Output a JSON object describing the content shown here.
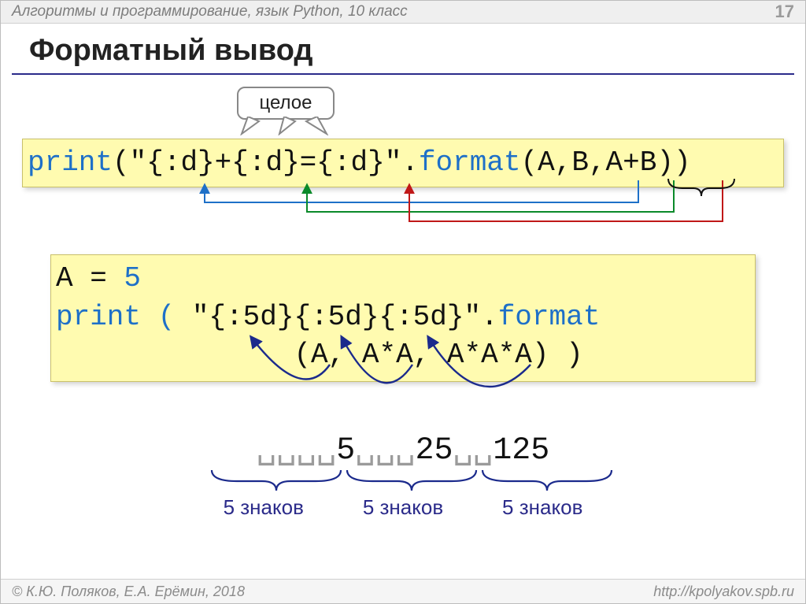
{
  "header": {
    "left": "Алгоритмы и программирование, язык Python, 10 класс",
    "page": "17"
  },
  "title": "Форматный вывод",
  "callout": "целое",
  "code1": {
    "print": "print",
    "open": "(",
    "str": "\"{:d}+{:d}={:d}\"",
    "dot": ".",
    "format": "format",
    "args": "(A,B,A+B))"
  },
  "code2": {
    "l1a": "A = ",
    "l1b": "5",
    "l2a": "print ( ",
    "l2b": "\"{:5d}{:5d}{:5d}\"",
    "l2c": ".",
    "l2d": "format",
    "l3": "              (A, A*A, A*A*A) )"
  },
  "output": {
    "v1": "5",
    "v2": "25",
    "v3": "125"
  },
  "signs": {
    "a": "5 знаков",
    "b": "5 знаков",
    "c": "5 знаков"
  },
  "footer": {
    "left": "© К.Ю. Поляков, Е.А. Ерёмин, 2018",
    "right": "http://kpolyakov.spb.ru"
  }
}
